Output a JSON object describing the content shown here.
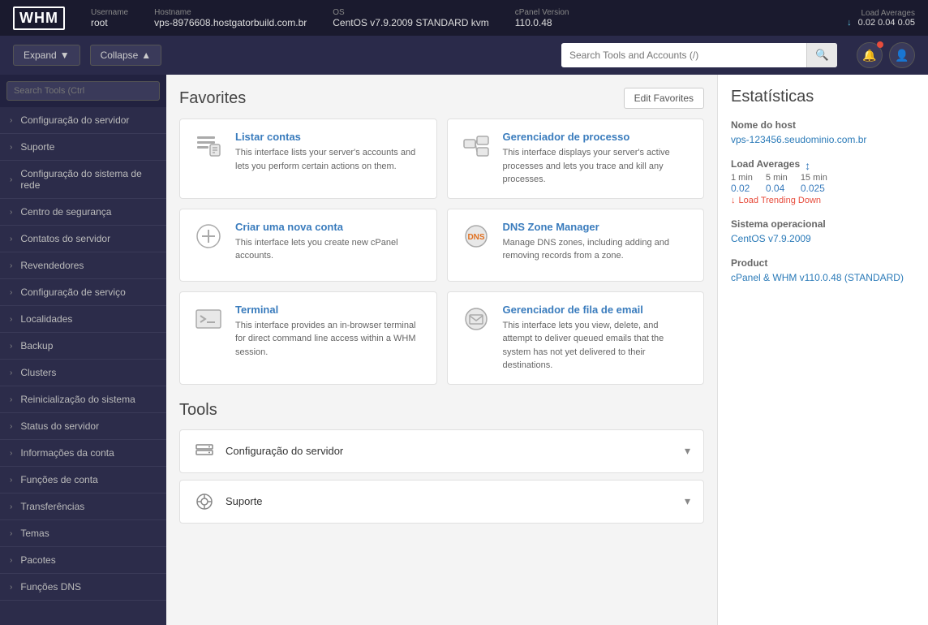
{
  "topbar": {
    "logo": "WHM",
    "fields": [
      {
        "label": "Username",
        "value": "root"
      },
      {
        "label": "Hostname",
        "value": "vps-8976608.hostgatorbuild.com.br"
      },
      {
        "label": "OS",
        "value": "CentOS v7.9.2009 STANDARD kvm"
      },
      {
        "label": "cPanel Version",
        "value": "110.0.48"
      }
    ],
    "load_averages_label": "Load Averages",
    "load_values": "0.02  0.04  0.05"
  },
  "header": {
    "expand_label": "Expand",
    "collapse_label": "Collapse",
    "search_placeholder": "Search Tools and Accounts (/)"
  },
  "sidebar": {
    "search_placeholder": "Search Tools (Ctrl",
    "items": [
      {
        "label": "Configuração do servidor"
      },
      {
        "label": "Suporte"
      },
      {
        "label": "Configuração do sistema de rede"
      },
      {
        "label": "Centro de segurança"
      },
      {
        "label": "Contatos do servidor"
      },
      {
        "label": "Revendedores"
      },
      {
        "label": "Configuração de serviço"
      },
      {
        "label": "Localidades"
      },
      {
        "label": "Backup"
      },
      {
        "label": "Clusters"
      },
      {
        "label": "Reinicialização do sistema"
      },
      {
        "label": "Status do servidor"
      },
      {
        "label": "Informações da conta"
      },
      {
        "label": "Funções de conta"
      },
      {
        "label": "Transferências"
      },
      {
        "label": "Temas"
      },
      {
        "label": "Pacotes"
      },
      {
        "label": "Funções DNS"
      }
    ]
  },
  "favorites": {
    "title": "Favorites",
    "edit_button": "Edit Favorites",
    "cards": [
      {
        "title": "Listar contas",
        "desc": "This interface lists your server's accounts and lets you perform certain actions on them.",
        "icon": "list"
      },
      {
        "title": "Gerenciador de processo",
        "desc": "This interface displays your server's active processes and lets you trace and kill any processes.",
        "icon": "process"
      },
      {
        "title": "Criar uma nova conta",
        "desc": "This interface lets you create new cPanel accounts.",
        "icon": "add-account"
      },
      {
        "title": "DNS Zone Manager",
        "desc": "Manage DNS zones, including adding and removing records from a zone.",
        "icon": "dns"
      },
      {
        "title": "Terminal",
        "desc": "This interface provides an in-browser terminal for direct command line access within a WHM session.",
        "icon": "terminal"
      },
      {
        "title": "Gerenciador de fila de email",
        "desc": "This interface lets you view, delete, and attempt to deliver queued emails that the system has not yet delivered to their destinations.",
        "icon": "email"
      }
    ]
  },
  "tools": {
    "title": "Tools",
    "sections": [
      {
        "label": "Configuração do servidor",
        "icon": "server-config"
      },
      {
        "label": "Suporte",
        "icon": "support"
      }
    ]
  },
  "stats": {
    "title": "Estatísticas",
    "hostname_label": "Nome do host",
    "hostname_value": "vps-123456.seudominio.com.br",
    "load_avg_label": "Load Averages",
    "load_1min_label": "1 min",
    "load_5min_label": "5 min",
    "load_15min_label": "15 min",
    "load_1min_value": "0.02",
    "load_5min_value": "0.04",
    "load_15min_value": "0.025",
    "load_trending": "Load Trending Down",
    "os_label": "Sistema operacional",
    "os_value": "CentOS v7.9.2009",
    "product_label": "Product",
    "product_value": "cPanel & WHM v110.0.48 (STANDARD)"
  }
}
